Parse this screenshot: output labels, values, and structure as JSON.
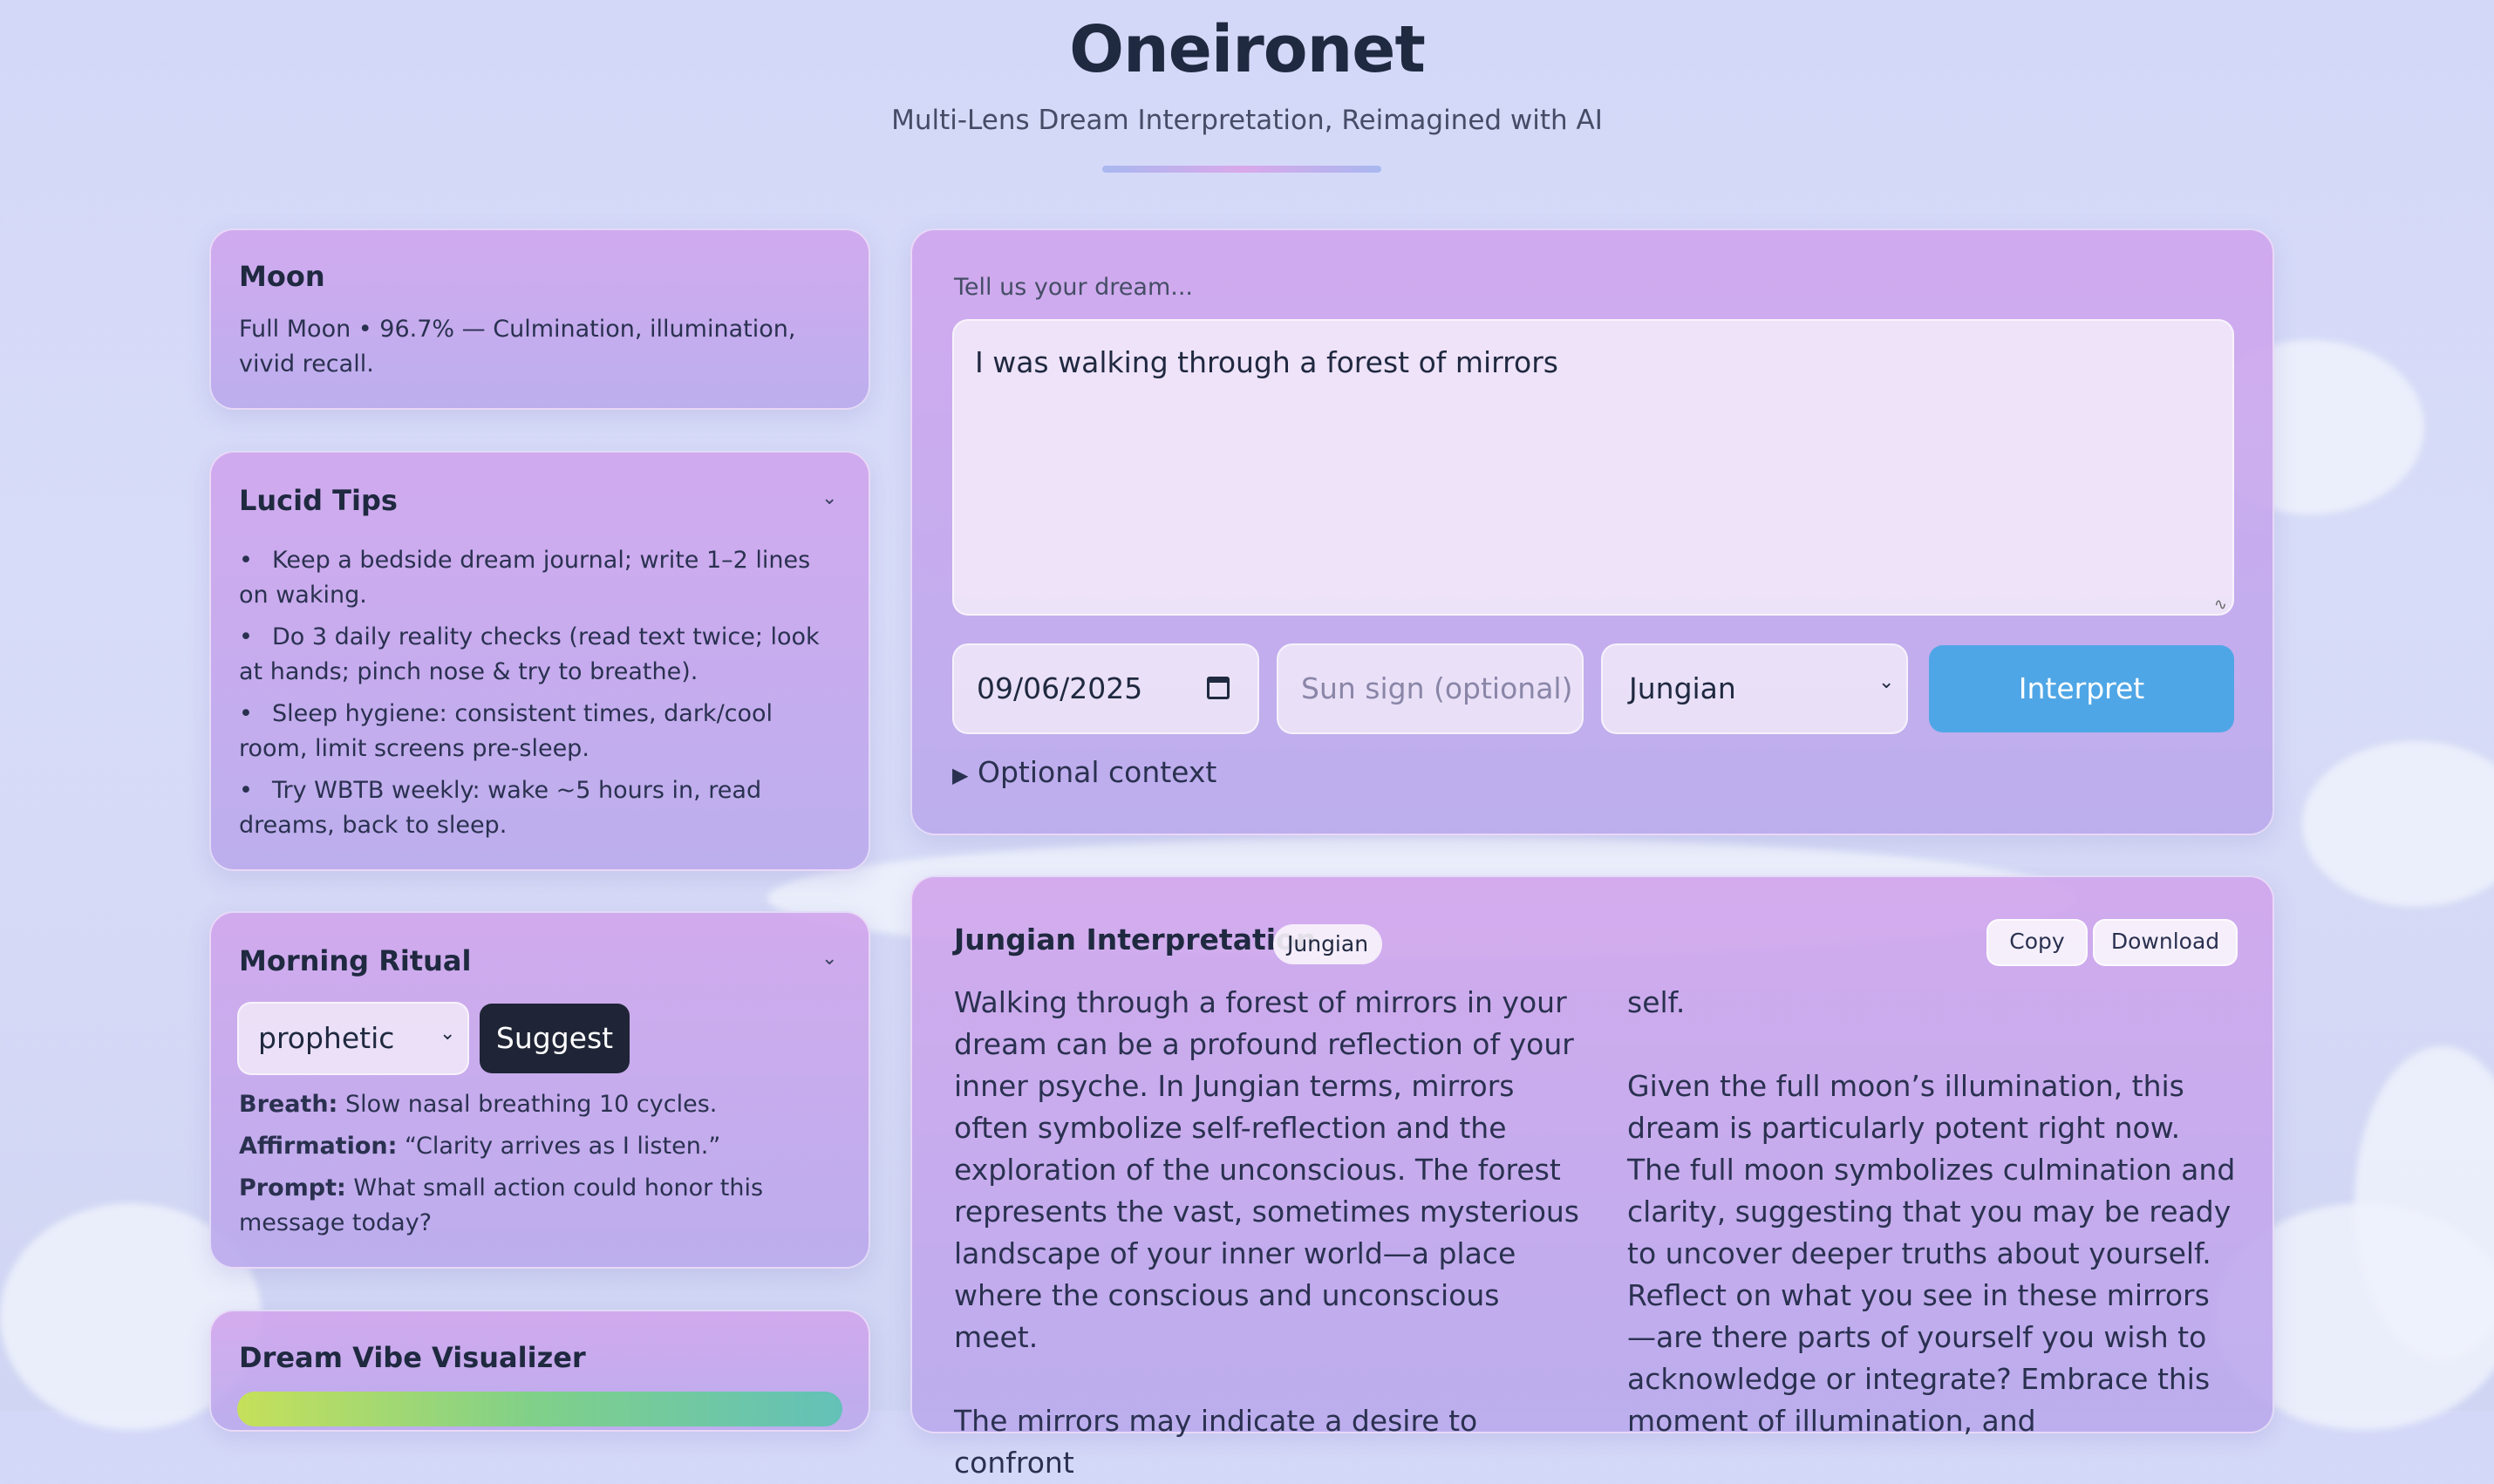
{
  "header": {
    "title": "Oneironet",
    "subtitle": "Multi-Lens Dream Interpretation, Reimagined with AI"
  },
  "moon": {
    "title": "Moon",
    "text": "Full Moon • 96.7% — Culmination, illumination, vivid recall."
  },
  "lucid": {
    "title": "Lucid Tips",
    "items": [
      "Keep a bedside dream journal; write 1–2 lines on waking.",
      "Do 3 daily reality checks (read text twice; look at hands; pinch nose & try to breathe).",
      "Sleep hygiene: consistent times, dark/cool room, limit screens pre-sleep.",
      "Try WBTB weekly: wake ~5 hours in, read dreams, back to sleep."
    ]
  },
  "ritual": {
    "title": "Morning Ritual",
    "select_value": "prophetic",
    "suggest_label": "Suggest",
    "breath_label": "Breath:",
    "breath_text": "Slow nasal breathing 10 cycles.",
    "affirmation_label": "Affirmation:",
    "affirmation_text": "“Clarity arrives as I listen.”",
    "prompt_label": "Prompt:",
    "prompt_text": "What small action could honor this message today?"
  },
  "visualizer": {
    "title": "Dream Vibe Visualizer"
  },
  "form": {
    "label": "Tell us your dream...",
    "dream_text": "I was walking through a forest of mirrors",
    "date_value": "09/06/2025",
    "sun_sign_placeholder": "Sun sign (optional)",
    "lens_value": "Jungian",
    "interpret_label": "Interpret",
    "optional_context": "Optional context"
  },
  "result": {
    "title": "Jungian Interpretation",
    "badge": "Jungian",
    "copy_label": "Copy",
    "download_label": "Download",
    "col1_p1": "Walking through a forest of mirrors in your dream can be a profound reflection of your inner psyche. In Jungian terms, mirrors often symbolize self-reflection and the exploration of the unconscious. The forest represents the vast, sometimes mysterious landscape of your inner world—a place where the conscious and unconscious meet.",
    "col1_p2": "The mirrors may indicate a desire to confront",
    "col2_p0": "self.",
    "col2_p1": "Given the full moon’s illumination, this dream is particularly potent right now. The full moon symbolizes culmination and clarity, suggesting that you may be ready to uncover deeper truths about yourself. Reflect on what you see in these mirrors—are there parts of yourself you wish to acknowledge or integrate? Embrace this moment of illumination, and"
  }
}
